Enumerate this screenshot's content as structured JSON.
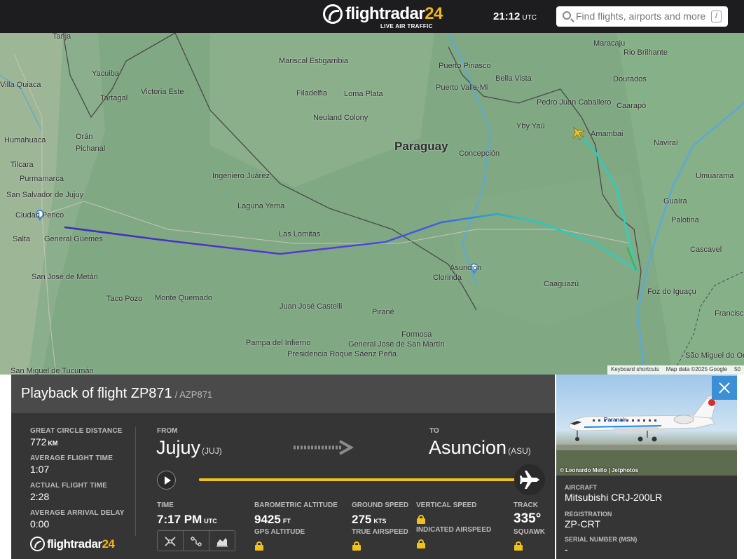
{
  "header": {
    "logo_text": "flightradar",
    "logo_num": "24",
    "logo_sub": "LIVE AIR TRAFFIC",
    "time": "21:12",
    "time_zone": "UTC",
    "search_placeholder": "Find flights, airports and more",
    "search_shortcut": "/"
  },
  "map": {
    "country_label": "Paraguay",
    "labels": [
      {
        "text": "Tarija",
        "cls": "city"
      },
      {
        "text": "Yacuiba",
        "cls": "city"
      },
      {
        "text": "Villa Quiaca",
        "cls": "city"
      },
      {
        "text": "Tartagal",
        "cls": "city"
      },
      {
        "text": "Victoria Este",
        "cls": "city"
      },
      {
        "text": "Mariscal Estigarribia",
        "cls": "city"
      },
      {
        "text": "Filadelfia",
        "cls": "city"
      },
      {
        "text": "Loma Plata",
        "cls": "city"
      },
      {
        "text": "Neuland Colony",
        "cls": "city"
      },
      {
        "text": "Puerto Pinasco",
        "cls": "city"
      },
      {
        "text": "Puerto Valle-Mi",
        "cls": "city"
      },
      {
        "text": "Bella Vista",
        "cls": "city"
      },
      {
        "text": "Pedro Juan Caballero",
        "cls": "city"
      },
      {
        "text": "Yby Yaú",
        "cls": "city"
      },
      {
        "text": "Concepción",
        "cls": "city"
      },
      {
        "text": "Humahuaca",
        "cls": "city"
      },
      {
        "text": "Orán",
        "cls": "city"
      },
      {
        "text": "Pichanal",
        "cls": "city"
      },
      {
        "text": "Tilcara",
        "cls": "city"
      },
      {
        "text": "Purmamarca",
        "cls": "city"
      },
      {
        "text": "San Salvador de Jujuy",
        "cls": "city"
      },
      {
        "text": "Ciudad Perico",
        "cls": "city"
      },
      {
        "text": "General Güemes",
        "cls": "city"
      },
      {
        "text": "Salta",
        "cls": "city"
      },
      {
        "text": "Ingeniero Juárez",
        "cls": "city"
      },
      {
        "text": "Laguna Yema",
        "cls": "city"
      },
      {
        "text": "Las Lomitas",
        "cls": "city"
      },
      {
        "text": "Asunción",
        "cls": "city"
      },
      {
        "text": "Clorinda",
        "cls": "city"
      },
      {
        "text": "San José de Metán",
        "cls": "city"
      },
      {
        "text": "Taco Pozo",
        "cls": "city"
      },
      {
        "text": "Monte Quemado",
        "cls": "city"
      },
      {
        "text": "Juan José Castelli",
        "cls": "city"
      },
      {
        "text": "Pirané",
        "cls": "city"
      },
      {
        "text": "Formosa",
        "cls": "city"
      },
      {
        "text": "Pampa del Infierno",
        "cls": "city"
      },
      {
        "text": "Presidencia Roque Sáenz Peña",
        "cls": "city"
      },
      {
        "text": "General José de San Martín",
        "cls": "city"
      },
      {
        "text": "San Miguel de Tucumán",
        "cls": "city"
      },
      {
        "text": "Maracaju",
        "cls": "city"
      },
      {
        "text": "Rio Brilhante",
        "cls": "city"
      },
      {
        "text": "Dourados",
        "cls": "city"
      },
      {
        "text": "Caarapó",
        "cls": "city"
      },
      {
        "text": "Amambai",
        "cls": "city"
      },
      {
        "text": "Naviraí",
        "cls": "city"
      },
      {
        "text": "Umuarama",
        "cls": "city"
      },
      {
        "text": "Guaíra",
        "cls": "city"
      },
      {
        "text": "Palotina",
        "cls": "city"
      },
      {
        "text": "Cascavel",
        "cls": "city"
      },
      {
        "text": "Caaguazú",
        "cls": "city"
      },
      {
        "text": "Foz do Iguaçu",
        "cls": "city"
      },
      {
        "text": "Francisco Beltrão",
        "cls": "city"
      },
      {
        "text": "São Miguel do Oeste",
        "cls": "city"
      }
    ],
    "attribution": [
      "Keyboard shortcuts",
      "Map data ©2025 Google",
      "50"
    ]
  },
  "flight": {
    "title": "Playback of flight ZP871",
    "callsign": "/ AZP871",
    "great_circle_label": "GREAT CIRCLE DISTANCE",
    "great_circle_value": "772",
    "great_circle_unit": "KM",
    "avg_time_label": "AVERAGE FLIGHT TIME",
    "avg_time_value": "1:07",
    "actual_time_label": "ACTUAL FLIGHT TIME",
    "actual_time_value": "2:28",
    "arrival_delay_label": "AVERAGE ARRIVAL DELAY",
    "arrival_delay_value": "0:00",
    "from_label": "FROM",
    "from_city": "Jujuy",
    "from_code": "(JUJ)",
    "to_label": "TO",
    "to_city": "Asuncion",
    "to_code": "(ASU)",
    "progress": 1.0,
    "time_label": "TIME",
    "time_value": "7:17 PM",
    "time_unit": "UTC",
    "baro_alt_label": "BAROMETRIC ALTITUDE",
    "baro_alt_value": "9425",
    "baro_alt_unit": "FT",
    "gps_alt_label": "GPS ALTITUDE",
    "ground_speed_label": "GROUND SPEED",
    "ground_speed_value": "275",
    "ground_speed_unit": "KTS",
    "true_airspeed_label": "TRUE AIRSPEED",
    "vertical_speed_label": "VERTICAL SPEED",
    "indicated_airspeed_label": "INDICATED AIRSPEED",
    "track_label": "TRACK",
    "track_value": "335°",
    "squawk_label": "SQUAWK"
  },
  "aircraft": {
    "photo_credit": "© Leonardo Mello | Jetphotos",
    "aircraft_label": "AIRCRAFT",
    "aircraft_value": "Mitsubishi CRJ-200LR",
    "registration_label": "REGISTRATION",
    "registration_value": "ZP-CRT",
    "serial_label": "SERIAL NUMBER (MSN)",
    "serial_value": "-",
    "livery_text": "Paranair"
  },
  "colors": {
    "accent": "#f2c21c",
    "panel": "#353535",
    "close": "#3b8fd6",
    "route_start": "#3a2fb8",
    "route_end": "#29d3c1"
  }
}
